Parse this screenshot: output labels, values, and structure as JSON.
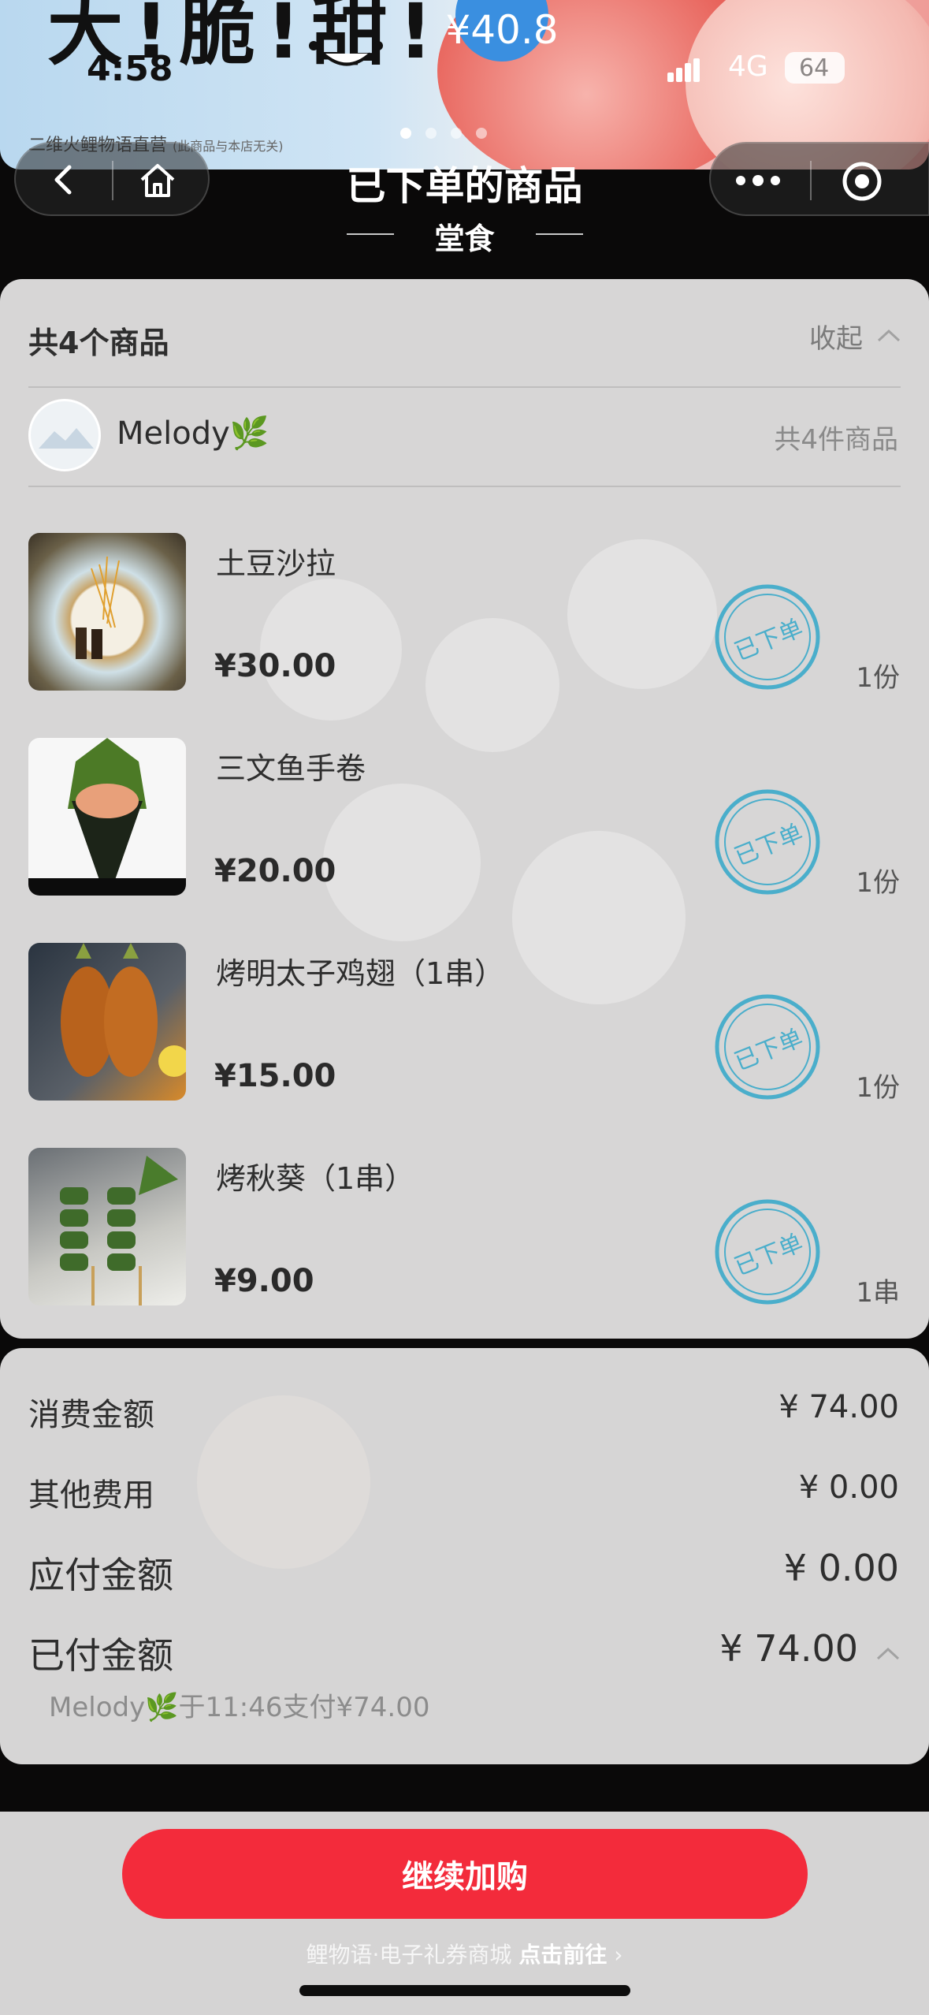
{
  "status_bar": {
    "time": "4:58",
    "network": "4G",
    "battery": "64"
  },
  "banner": {
    "headline": "大!脆!甜!",
    "price": "¥40.8",
    "brand": "二维火鲤物语直营",
    "brand_note": "(此商品与本店无关)"
  },
  "nav": {
    "title": "已下单的商品",
    "subtitle": "堂食"
  },
  "order": {
    "header": "共4个商品",
    "collapse_label": "收起",
    "user_name": "Melody🌿",
    "item_count": "共4件商品",
    "items": [
      {
        "name": "土豆沙拉",
        "price": "¥30.00",
        "qty": "1份",
        "stamp": "已下单"
      },
      {
        "name": "三文鱼手卷",
        "price": "¥20.00",
        "qty": "1份",
        "stamp": "已下单"
      },
      {
        "name": "烤明太子鸡翅（1串）",
        "price": "¥15.00",
        "qty": "1份",
        "stamp": "已下单"
      },
      {
        "name": "烤秋葵（1串）",
        "price": "¥9.00",
        "qty": "1串",
        "stamp": "已下单"
      }
    ]
  },
  "summary": {
    "consume_label": "消费金额",
    "consume_value": "¥ 74.00",
    "other_label": "其他费用",
    "other_value": "¥ 0.00",
    "payable_label": "应付金额",
    "payable_value": "¥ 0.00",
    "paid_label": "已付金额",
    "paid_value": "¥ 74.00",
    "paid_note": "Melody🌿于11:46支付¥74.00"
  },
  "bottom": {
    "button": "继续加购",
    "footer_text": "鲤物语·电子礼券商城",
    "footer_link": "点击前往"
  },
  "colors": {
    "accent": "#f32b3b",
    "stamp": "#4aaecb"
  }
}
